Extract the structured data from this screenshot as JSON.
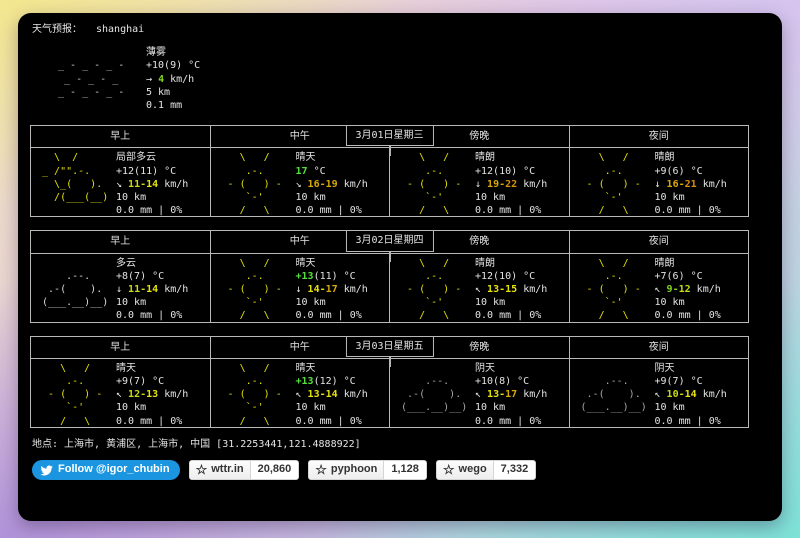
{
  "palette": {
    "text": "#e4e4e4",
    "border": "#b9b9b9",
    "temp_green": "#55e13b",
    "wind_green": "#83d41c",
    "wind_lime": "#c6dc13",
    "wind_yellow": "#e6e20d",
    "wind_gold": "#d8a90c",
    "wind_orange": "#dd8e0b",
    "twitter_blue": "#1b95e0"
  },
  "art_colors": {
    "sunny": "#e5e10b",
    "partlycloudy": "#e5e10b",
    "cloudy": "#dcdcdc",
    "overcast": "#a8a8a8",
    "mist": "#cfcfcf"
  },
  "ascii_art": {
    "sunny": [
      "    \\   /",
      "     .-.",
      "  - (   ) -",
      "     `-'",
      "    /   \\"
    ],
    "partlycloudy": [
      "   \\  /",
      " _ /\"\".-.",
      "   \\_(   ).",
      "   /(___(__)",
      ""
    ],
    "cloudy": [
      "",
      "     .--.",
      "  .-(    ).",
      " (___.__)__)",
      ""
    ],
    "overcast": [
      "",
      "     .--.",
      "  .-(    ).",
      " (___.__)__)",
      ""
    ],
    "mist": [
      "",
      " _ - _ - _ -",
      "  _ - _ - _",
      " _ - _ - _ -",
      ""
    ]
  },
  "header": {
    "label": "天气预报：",
    "location": "shanghai"
  },
  "current": {
    "art": "mist",
    "condition": "薄雾",
    "temp": "+10(9) °C",
    "wind_dir": "→",
    "wind_speed": "4",
    "wind_color": "wind_green",
    "wind_unit": "km/h",
    "visibility": "5 km",
    "precip": "0.1 mm"
  },
  "columns": [
    "早上",
    "中午",
    "傍晚",
    "夜间"
  ],
  "wind_sep": "-",
  "days": [
    {
      "date": "3月01日星期三",
      "cells": [
        {
          "art": "partlycloudy",
          "condition": "局部多云",
          "temp_hl": "",
          "temp_rest": "+12(11)",
          "wind_dir": "↘",
          "wind_lo": "11",
          "wind_hi": "14",
          "wind_lo_color": "wind_lime",
          "wind_hi_color": "wind_yellow",
          "visibility": "10 km",
          "precip": "0.0 mm",
          "chance": "0%"
        },
        {
          "art": "sunny",
          "condition": "晴天",
          "temp_hl": "17",
          "temp_rest": "",
          "wind_dir": "↘",
          "wind_lo": "16",
          "wind_hi": "19",
          "wind_lo_color": "wind_gold",
          "wind_hi_color": "wind_gold",
          "visibility": "10 km",
          "precip": "0.0 mm",
          "chance": "0%"
        },
        {
          "art": "sunny",
          "condition": "晴朗",
          "temp_hl": "",
          "temp_rest": "+12(10)",
          "wind_dir": "↓",
          "wind_lo": "19",
          "wind_hi": "22",
          "wind_lo_color": "wind_gold",
          "wind_hi_color": "wind_orange",
          "visibility": "10 km",
          "precip": "0.0 mm",
          "chance": "0%"
        },
        {
          "art": "sunny",
          "condition": "晴朗",
          "temp_hl": "",
          "temp_rest": "+9(6)",
          "wind_dir": "↓",
          "wind_lo": "16",
          "wind_hi": "21",
          "wind_lo_color": "wind_gold",
          "wind_hi_color": "wind_orange",
          "visibility": "10 km",
          "precip": "0.0 mm",
          "chance": "0%"
        }
      ]
    },
    {
      "date": "3月02日星期四",
      "cells": [
        {
          "art": "cloudy",
          "condition": "多云",
          "temp_hl": "",
          "temp_rest": "+8(7)",
          "wind_dir": "↓",
          "wind_lo": "11",
          "wind_hi": "14",
          "wind_lo_color": "wind_lime",
          "wind_hi_color": "wind_yellow",
          "visibility": "10 km",
          "precip": "0.0 mm",
          "chance": "0%"
        },
        {
          "art": "sunny",
          "condition": "晴天",
          "temp_hl": "+13",
          "temp_rest": "(11)",
          "wind_dir": "↓",
          "wind_lo": "14",
          "wind_hi": "17",
          "wind_lo_color": "wind_yellow",
          "wind_hi_color": "wind_gold",
          "visibility": "10 km",
          "precip": "0.0 mm",
          "chance": "0%"
        },
        {
          "art": "sunny",
          "condition": "晴朗",
          "temp_hl": "",
          "temp_rest": "+12(10)",
          "wind_dir": "↖",
          "wind_lo": "13",
          "wind_hi": "15",
          "wind_lo_color": "wind_yellow",
          "wind_hi_color": "wind_yellow",
          "visibility": "10 km",
          "precip": "0.0 mm",
          "chance": "0%"
        },
        {
          "art": "sunny",
          "condition": "晴朗",
          "temp_hl": "",
          "temp_rest": "+7(6)",
          "wind_dir": "↖",
          "wind_lo": "9",
          "wind_hi": "12",
          "wind_lo_color": "wind_green",
          "wind_hi_color": "wind_lime",
          "visibility": "10 km",
          "precip": "0.0 mm",
          "chance": "0%"
        }
      ]
    },
    {
      "date": "3月03日星期五",
      "cells": [
        {
          "art": "sunny",
          "condition": "晴天",
          "temp_hl": "",
          "temp_rest": "+9(7)",
          "wind_dir": "↖",
          "wind_lo": "12",
          "wind_hi": "13",
          "wind_lo_color": "wind_lime",
          "wind_hi_color": "wind_yellow",
          "visibility": "10 km",
          "precip": "0.0 mm",
          "chance": "0%"
        },
        {
          "art": "sunny",
          "condition": "晴天",
          "temp_hl": "+13",
          "temp_rest": "(12)",
          "wind_dir": "↖",
          "wind_lo": "13",
          "wind_hi": "14",
          "wind_lo_color": "wind_yellow",
          "wind_hi_color": "wind_yellow",
          "visibility": "10 km",
          "precip": "0.0 mm",
          "chance": "0%"
        },
        {
          "art": "overcast",
          "condition": "阴天",
          "temp_hl": "",
          "temp_rest": "+10(8)",
          "wind_dir": "↖",
          "wind_lo": "13",
          "wind_hi": "17",
          "wind_lo_color": "wind_yellow",
          "wind_hi_color": "wind_gold",
          "visibility": "10 km",
          "precip": "0.0 mm",
          "chance": "0%"
        },
        {
          "art": "overcast",
          "condition": "阴天",
          "temp_hl": "",
          "temp_rest": "+9(7)",
          "wind_dir": "↖",
          "wind_lo": "10",
          "wind_hi": "14",
          "wind_lo_color": "wind_lime",
          "wind_hi_color": "wind_yellow",
          "visibility": "10 km",
          "precip": "0.0 mm",
          "chance": "0%"
        }
      ]
    }
  ],
  "footer": {
    "location_line": "地点: 上海市, 黄浦区, 上海市, 中国 [31.2253441,121.4888922]",
    "twitter_label": "Follow @igor_chubin",
    "badges": [
      {
        "name": "wttr.in",
        "count": "20,860"
      },
      {
        "name": "pyphoon",
        "count": "1,128"
      },
      {
        "name": "wego",
        "count": "7,332"
      }
    ]
  }
}
